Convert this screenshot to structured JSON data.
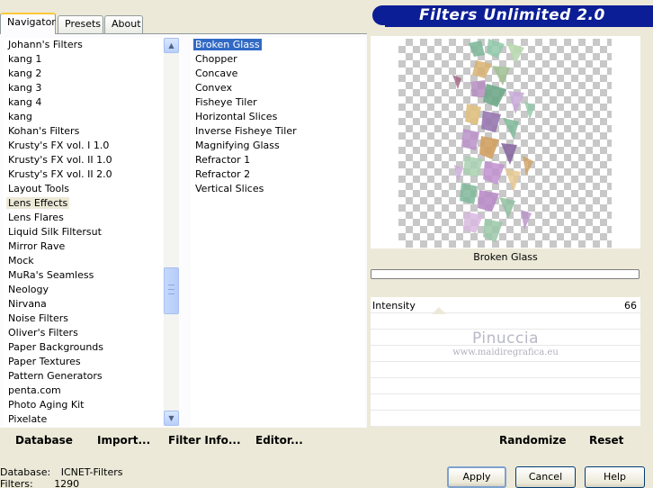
{
  "tabs": [
    {
      "label": "Navigator"
    },
    {
      "label": "Presets"
    },
    {
      "label": "About"
    }
  ],
  "title": "Filters Unlimited 2.0",
  "categories": [
    "Johann's Filters",
    "kang 1",
    "kang 2",
    "kang 3",
    "kang 4",
    "kang",
    "Kohan's Filters",
    "Krusty's FX vol. I 1.0",
    "Krusty's FX vol. II 1.0",
    "Krusty's FX vol. II 2.0",
    "Layout Tools",
    "Lens Effects",
    "Lens Flares",
    "Liquid Silk Filtersut",
    "Mirror Rave",
    "Mock",
    "MuRa's Seamless",
    "Neology",
    "Nirvana",
    "Noise Filters",
    "Oliver's Filters",
    "Paper Backgrounds",
    "Paper Textures",
    "Pattern Generators",
    "penta.com",
    "Photo Aging Kit",
    "Pixelate"
  ],
  "selected_category": "Lens Effects",
  "filters": [
    "Broken Glass",
    "Chopper",
    "Concave",
    "Convex",
    "Fisheye Tiler",
    "Horizontal Slices",
    "Inverse Fisheye Tiler",
    "Magnifying Glass",
    "Refractor 1",
    "Refractor 2",
    "Vertical Slices"
  ],
  "selected_filter": "Broken Glass",
  "left_buttons": {
    "database": "Database",
    "import": "Import...",
    "filter_info": "Filter Info...",
    "editor": "Editor..."
  },
  "preview": {
    "filter_name": "Broken Glass"
  },
  "params": {
    "intensity_label": "Intensity",
    "intensity_value": "66"
  },
  "watermark": {
    "name": "Pinuccia",
    "url": "www.maidiregrafica.eu"
  },
  "right_buttons": {
    "randomize": "Randomize",
    "reset": "Reset"
  },
  "status": {
    "database_label": "Database:",
    "database_value": "ICNET-Filters",
    "filters_label": "Filters:",
    "filters_value": "1290"
  },
  "dialog_buttons": {
    "apply": "Apply",
    "cancel": "Cancel",
    "help": "Help"
  },
  "colors": {
    "banner": "#0b1e96",
    "selection": "#316ac5",
    "window_bg": "#ece9d8"
  }
}
